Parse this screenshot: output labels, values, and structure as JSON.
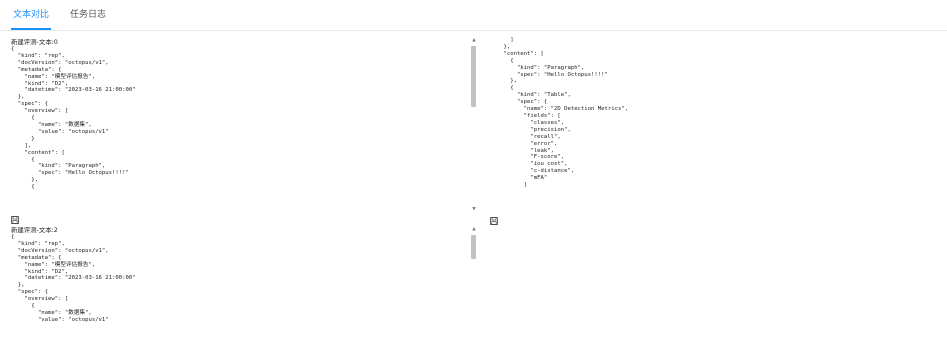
{
  "tabs": [
    {
      "label": "文本对比",
      "active": true
    },
    {
      "label": "任务日志",
      "active": false
    }
  ],
  "accent_color": "#1890ff",
  "panes": {
    "top_left": {
      "title": "新建评测-文本:0",
      "lines": [
        "{",
        "  \"kind\": \"rep\",",
        "  \"docVersion\": \"octopus/v1\",",
        "  \"metadata\": {",
        "    \"name\": \"模型评估报告\",",
        "    \"kind\": \"D2\",",
        "    \"datetime\": \"2023-03-16 21:00:00\"",
        "  },",
        "  \"spec\": {",
        "    \"overview\": [",
        "      {",
        "        \"name\": \"数据集\",",
        "        \"value\": \"octopus/v1\"",
        "      }",
        "    ],",
        "    \"content\": [",
        "      {",
        "        \"kind\": \"Paragraph\",",
        "        \"spec\": \"Hello Octopus!!!!\"",
        "      },",
        "      {"
      ],
      "icon": "save-icon"
    },
    "top_right": {
      "lines": [
        "      ]",
        "    },",
        "    \"content\": [",
        "      {",
        "        \"kind\": \"Paragraph\",",
        "        \"spec\": \"Hello Octopus!!!!\"",
        "      },",
        "      {",
        "        \"kind\": \"Table\",",
        "        \"spec\": {",
        "          \"name\": \"2D Detection Metrics\",",
        "          \"fields\": [",
        "            \"classes\",",
        "            \"precision\",",
        "            \"recall\",",
        "            \"error\",",
        "            \"leak\",",
        "            \"F-score\",",
        "            \"iou cost\",",
        "            \"c-distance\",",
        "            \"mFA\"",
        "          ]"
      ],
      "icon": "save-icon"
    },
    "bottom_left": {
      "title": "新建评测-文本:2",
      "lines": [
        "{",
        "  \"kind\": \"rep\",",
        "  \"docVersion\": \"octopus/v1\",",
        "  \"metadata\": {",
        "    \"name\": \"模型评估报告\",",
        "    \"kind\": \"D2\",",
        "    \"datetime\": \"2023-03-16 21:00:00\"",
        "  },",
        "  \"spec\": {",
        "    \"overview\": [",
        "      {",
        "        \"name\": \"数据集\",",
        "        \"value\": \"octopus/v1\""
      ]
    }
  }
}
